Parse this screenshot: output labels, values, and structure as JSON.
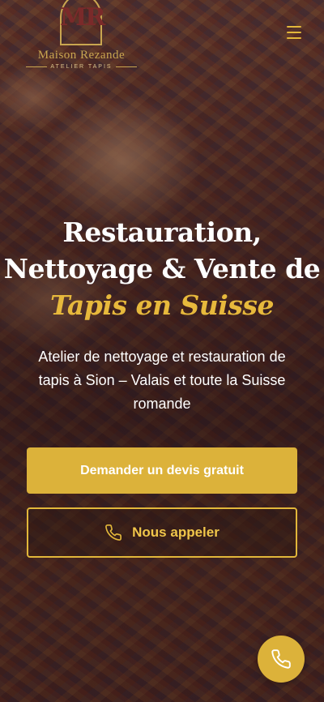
{
  "header": {
    "logo_monogram": "MR",
    "logo_name": "Maison Rezande",
    "logo_tagline": "ATELIER TAPIS",
    "menu_icon": "hamburger-icon"
  },
  "hero": {
    "title_line1": "Restauration,",
    "title_line2": "Nettoyage & Vente de",
    "title_accent": "Tapis en Suisse",
    "subtitle": "Atelier de nettoyage et restauration de tapis à Sion – Valais et toute la Suisse romande"
  },
  "actions": {
    "quote_label": "Demander un devis gratuit",
    "call_label": "Nous appeler",
    "call_icon": "phone-icon"
  },
  "floating": {
    "call_icon": "phone-icon"
  },
  "colors": {
    "accent": "#dcb23a",
    "accent_text": "#e7b93c"
  }
}
